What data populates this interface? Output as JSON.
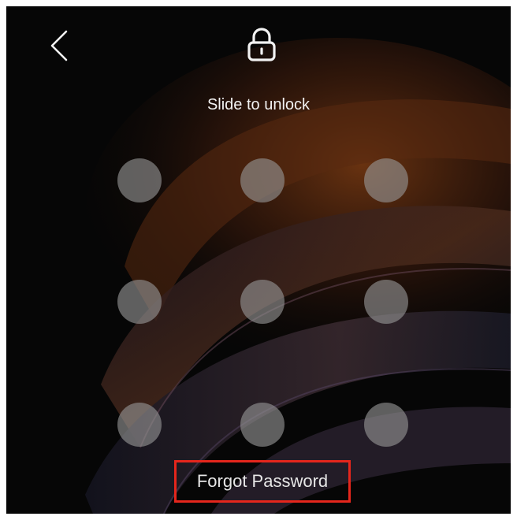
{
  "screen": {
    "hint_text": "Slide to unlock",
    "forgot_label": "Forgot Password"
  },
  "icons": {
    "back": "chevron-left-icon",
    "lock": "padlock-icon"
  },
  "pattern": {
    "rows": 3,
    "cols": 3
  },
  "colors": {
    "background": "#060606",
    "text": "#f2f2f2",
    "dot": "#969696",
    "highlight_border": "#e5261c",
    "wallpaper_accent": "#6a3414"
  }
}
